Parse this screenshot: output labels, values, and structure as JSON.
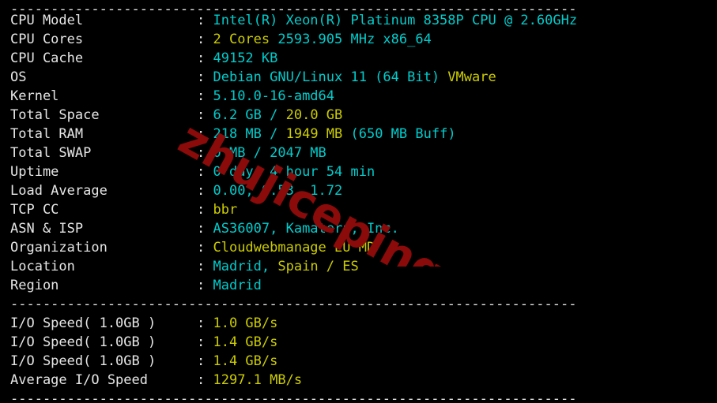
{
  "terminal": {
    "separator_top": "----------------------------------------------------------------------",
    "separator_mid": "----------------------------------------------------------------------",
    "separator_bottom": "----------------------------------------------------------------------",
    "colon": ":"
  },
  "watermark": {
    "text": "zhujiceping.com",
    "color": "#8b0a0a",
    "rotation_deg": 29
  },
  "colors": {
    "background": "#000000",
    "label": "#e6e6e6",
    "cyan": "#00cdcd",
    "yellow": "#cdcd00"
  },
  "system_info": [
    {
      "label": "CPU Model",
      "value": "Intel(R) Xeon(R) Platinum 8358P CPU @ 2.60GHz",
      "parts": [
        {
          "t": "Intel(R) Xeon(R) Platinum 8358P CPU @ 2.60GHz",
          "c": "cyan"
        }
      ]
    },
    {
      "label": "CPU Cores",
      "value": "2 Cores 2593.905 MHz x86_64",
      "parts": [
        {
          "t": "2 Cores ",
          "c": "yellow"
        },
        {
          "t": "2593.905 MHz x86_64",
          "c": "cyan"
        }
      ]
    },
    {
      "label": "CPU Cache",
      "value": "49152 KB",
      "parts": [
        {
          "t": "49152 KB",
          "c": "cyan"
        }
      ]
    },
    {
      "label": "OS",
      "value": "Debian GNU/Linux 11 (64 Bit) VMware",
      "parts": [
        {
          "t": "Debian GNU/Linux 11 (64 Bit) ",
          "c": "cyan"
        },
        {
          "t": "VMware",
          "c": "yellow"
        }
      ]
    },
    {
      "label": "Kernel",
      "value": "5.10.0-16-amd64",
      "parts": [
        {
          "t": "5.10.0-16-amd64",
          "c": "cyan"
        }
      ]
    },
    {
      "label": "Total Space",
      "value": "6.2 GB / 20.0 GB",
      "parts": [
        {
          "t": "6.2 GB / ",
          "c": "cyan"
        },
        {
          "t": "20.0 GB",
          "c": "yellow"
        }
      ]
    },
    {
      "label": "Total RAM",
      "value": "218 MB / 1949 MB (650 MB Buff)",
      "parts": [
        {
          "t": "218 MB / ",
          "c": "cyan"
        },
        {
          "t": "1949 MB ",
          "c": "yellow"
        },
        {
          "t": "(650 MB Buff)",
          "c": "cyan"
        }
      ]
    },
    {
      "label": "Total SWAP",
      "value": "0 MB / 2047 MB",
      "parts": [
        {
          "t": "0 MB / 2047 MB",
          "c": "cyan"
        }
      ]
    },
    {
      "label": "Uptime",
      "value": "0 days 4 hour 54 min",
      "parts": [
        {
          "t": "0 days 4 hour 54 min",
          "c": "cyan"
        }
      ]
    },
    {
      "label": "Load Average",
      "value": "0.00, 0.53, 1.72",
      "parts": [
        {
          "t": "0.00, 0.53, 1.72",
          "c": "cyan"
        }
      ]
    },
    {
      "label": "TCP CC",
      "value": "bbr",
      "parts": [
        {
          "t": "bbr",
          "c": "yellow"
        }
      ]
    },
    {
      "label": "ASN & ISP",
      "value": "AS36007, Kamatera, Inc.",
      "parts": [
        {
          "t": "AS36007, Kamatera, Inc.",
          "c": "cyan"
        }
      ]
    },
    {
      "label": "Organization",
      "value": "Cloudwebmanage EU MD",
      "parts": [
        {
          "t": "Cloudwebmanage EU MD",
          "c": "yellow"
        }
      ]
    },
    {
      "label": "Location",
      "value": "Madrid, Spain / ES",
      "parts": [
        {
          "t": "Madrid, ",
          "c": "cyan"
        },
        {
          "t": "Spain / ES",
          "c": "yellow"
        }
      ]
    },
    {
      "label": "Region",
      "value": "Madrid",
      "parts": [
        {
          "t": "Madrid",
          "c": "cyan"
        }
      ]
    }
  ],
  "io_speed": [
    {
      "label": "I/O Speed( 1.0GB )",
      "value": "1.0 GB/s",
      "parts": [
        {
          "t": "1.0 GB/s",
          "c": "yellow"
        }
      ]
    },
    {
      "label": "I/O Speed( 1.0GB )",
      "value": "1.4 GB/s",
      "parts": [
        {
          "t": "1.4 GB/s",
          "c": "yellow"
        }
      ]
    },
    {
      "label": "I/O Speed( 1.0GB )",
      "value": "1.4 GB/s",
      "parts": [
        {
          "t": "1.4 GB/s",
          "c": "yellow"
        }
      ]
    },
    {
      "label": "Average I/O Speed",
      "value": "1297.1 MB/s",
      "parts": [
        {
          "t": "1297.1 MB/s",
          "c": "yellow"
        }
      ]
    }
  ]
}
